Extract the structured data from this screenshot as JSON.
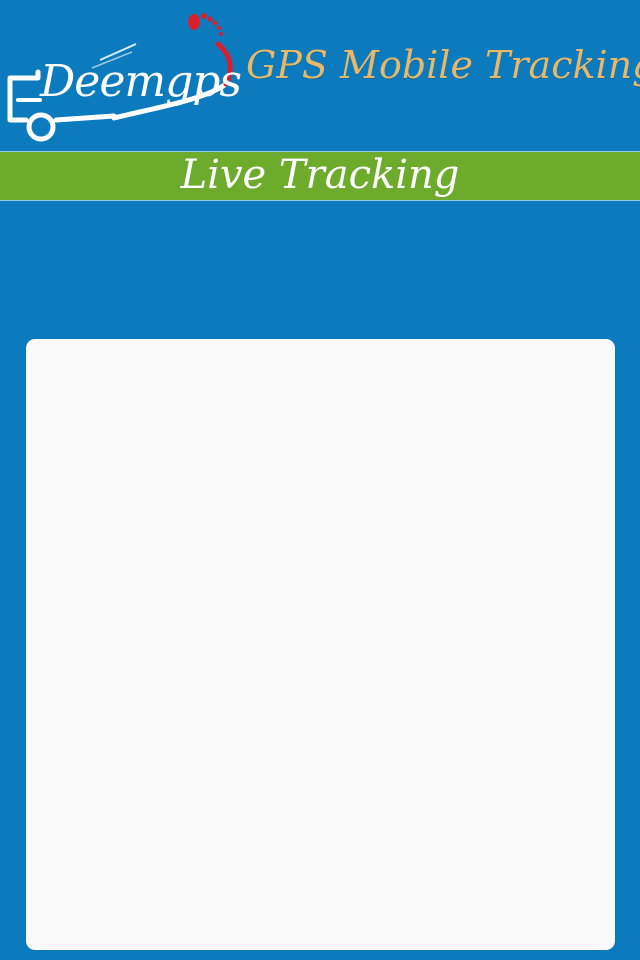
{
  "header": {
    "logo": {
      "text": "Deemgps",
      "icon": "footprint-icon",
      "accent_color": "#d81f2b"
    },
    "app_title": "GPS Mobile Tracking",
    "title_color": "#e8b86a",
    "background_color": "#0b7bbd"
  },
  "tracking_bar": {
    "title": "Live Tracking",
    "color": "#6dab2c"
  },
  "main": {
    "panel_color": "#f9f9f9"
  }
}
